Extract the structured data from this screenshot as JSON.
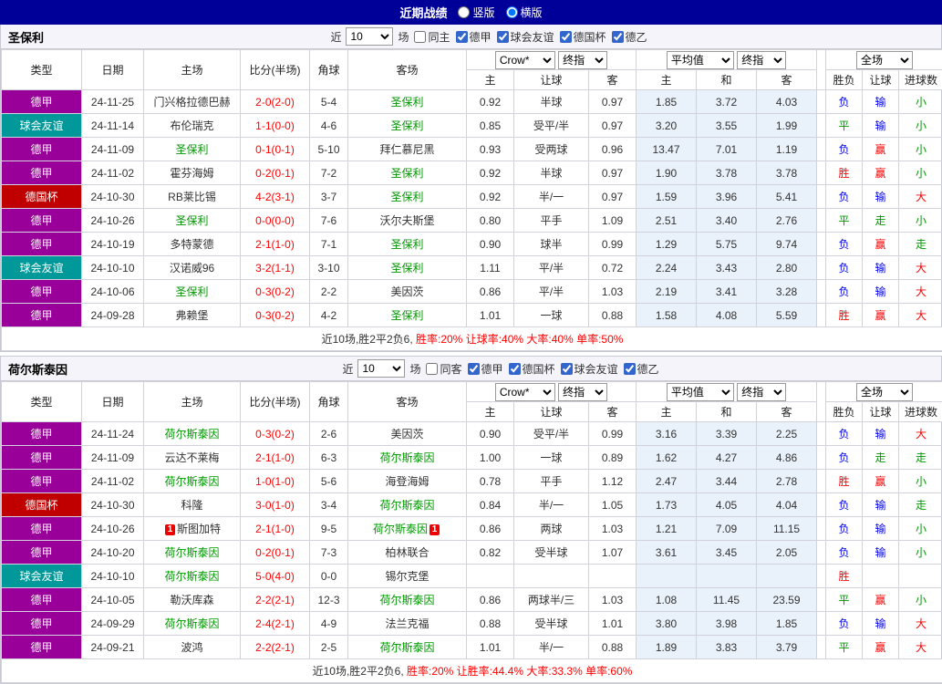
{
  "topbar": {
    "title": "近期战绩",
    "layout_options": [
      {
        "label": "竖版",
        "checked": false
      },
      {
        "label": "横版",
        "checked": true
      }
    ]
  },
  "colors": {
    "topbar_bg": "#000099",
    "league": {
      "德甲": "#990099",
      "球会友谊": "#009898",
      "德国杯": "#C00000"
    },
    "result": {
      "胜": "#FF0000",
      "平": "#009900",
      "负": "#0000EE",
      "赢": "#FF0000",
      "输": "#0000EE",
      "走": "#009900",
      "大": "#FF0000",
      "小": "#009900"
    },
    "focus_team": "#009900",
    "score": "#FF0000",
    "avg_col_bg": "#E9F1FB"
  },
  "table_header": {
    "type": "类型",
    "date": "日期",
    "home": "主场",
    "score": "比分(半场)",
    "corner": "角球",
    "away": "客场",
    "odds_book_select": "Crow*",
    "odds_final_select": "终指",
    "avg_select": "平均值",
    "avg_final_select": "终指",
    "full_select": "全场",
    "odds_sub": [
      "主",
      "让球",
      "客"
    ],
    "avg_sub": [
      "主",
      "和",
      "客"
    ],
    "result_sub": [
      "胜负",
      "让球",
      "进球数"
    ]
  },
  "sections": [
    {
      "team": "圣保利",
      "filter": {
        "near": "近",
        "count": "10",
        "unit": "场",
        "same": {
          "label": "同主",
          "checked": false
        },
        "leagues": [
          {
            "label": "德甲",
            "checked": true
          },
          {
            "label": "球会友谊",
            "checked": true
          },
          {
            "label": "德国杯",
            "checked": true
          },
          {
            "label": "德乙",
            "checked": true
          }
        ]
      },
      "rows": [
        {
          "league": "德甲",
          "date": "24-11-25",
          "home": "门兴格拉德巴赫",
          "score": "2-0(2-0)",
          "corner": "5-4",
          "away": "圣保利",
          "odds": [
            "0.92",
            "半球",
            "0.97"
          ],
          "avg": [
            "1.85",
            "3.72",
            "4.03"
          ],
          "result": [
            "负",
            "输",
            "小"
          ]
        },
        {
          "league": "球会友谊",
          "date": "24-11-14",
          "home": "布伦瑞克",
          "score": "1-1(0-0)",
          "corner": "4-6",
          "away": "圣保利",
          "odds": [
            "0.85",
            "受平/半",
            "0.97"
          ],
          "avg": [
            "3.20",
            "3.55",
            "1.99"
          ],
          "result": [
            "平",
            "输",
            "小"
          ]
        },
        {
          "league": "德甲",
          "date": "24-11-09",
          "home": "圣保利",
          "score": "0-1(0-1)",
          "corner": "5-10",
          "away": "拜仁慕尼黑",
          "odds": [
            "0.93",
            "受两球",
            "0.96"
          ],
          "avg": [
            "13.47",
            "7.01",
            "1.19"
          ],
          "result": [
            "负",
            "赢",
            "小"
          ]
        },
        {
          "league": "德甲",
          "date": "24-11-02",
          "home": "霍芬海姆",
          "score": "0-2(0-1)",
          "corner": "7-2",
          "away": "圣保利",
          "odds": [
            "0.92",
            "半球",
            "0.97"
          ],
          "avg": [
            "1.90",
            "3.78",
            "3.78"
          ],
          "result": [
            "胜",
            "赢",
            "小"
          ]
        },
        {
          "league": "德国杯",
          "date": "24-10-30",
          "home": "RB莱比锡",
          "score": "4-2(3-1)",
          "corner": "3-7",
          "away": "圣保利",
          "odds": [
            "0.92",
            "半/一",
            "0.97"
          ],
          "avg": [
            "1.59",
            "3.96",
            "5.41"
          ],
          "result": [
            "负",
            "输",
            "大"
          ]
        },
        {
          "league": "德甲",
          "date": "24-10-26",
          "home": "圣保利",
          "score": "0-0(0-0)",
          "corner": "7-6",
          "away": "沃尔夫斯堡",
          "odds": [
            "0.80",
            "平手",
            "1.09"
          ],
          "avg": [
            "2.51",
            "3.40",
            "2.76"
          ],
          "result": [
            "平",
            "走",
            "小"
          ]
        },
        {
          "league": "德甲",
          "date": "24-10-19",
          "home": "多特蒙德",
          "score": "2-1(1-0)",
          "corner": "7-1",
          "away": "圣保利",
          "odds": [
            "0.90",
            "球半",
            "0.99"
          ],
          "avg": [
            "1.29",
            "5.75",
            "9.74"
          ],
          "result": [
            "负",
            "赢",
            "走"
          ]
        },
        {
          "league": "球会友谊",
          "date": "24-10-10",
          "home": "汉诺威96",
          "score": "3-2(1-1)",
          "corner": "3-10",
          "away": "圣保利",
          "odds": [
            "1.11",
            "平/半",
            "0.72"
          ],
          "avg": [
            "2.24",
            "3.43",
            "2.80"
          ],
          "result": [
            "负",
            "输",
            "大"
          ]
        },
        {
          "league": "德甲",
          "date": "24-10-06",
          "home": "圣保利",
          "score": "0-3(0-2)",
          "corner": "2-2",
          "away": "美因茨",
          "odds": [
            "0.86",
            "平/半",
            "1.03"
          ],
          "avg": [
            "2.19",
            "3.41",
            "3.28"
          ],
          "result": [
            "负",
            "输",
            "大"
          ]
        },
        {
          "league": "德甲",
          "date": "24-09-28",
          "home": "弗赖堡",
          "score": "0-3(0-2)",
          "corner": "4-2",
          "away": "圣保利",
          "odds": [
            "1.01",
            "一球",
            "0.88"
          ],
          "avg": [
            "1.58",
            "4.08",
            "5.59"
          ],
          "result": [
            "胜",
            "赢",
            "大"
          ]
        }
      ],
      "footer": [
        {
          "text": "近10场,胜2平2负6, ",
          "color": "#333333"
        },
        {
          "text": "胜率:20% ",
          "color": "#FF0000"
        },
        {
          "text": "让球率:40% ",
          "color": "#FF0000"
        },
        {
          "text": "大率:40% ",
          "color": "#FF0000"
        },
        {
          "text": "单率:50%",
          "color": "#FF0000"
        }
      ]
    },
    {
      "team": "荷尔斯泰因",
      "filter": {
        "near": "近",
        "count": "10",
        "unit": "场",
        "same": {
          "label": "同客",
          "checked": false
        },
        "leagues": [
          {
            "label": "德甲",
            "checked": true
          },
          {
            "label": "德国杯",
            "checked": true
          },
          {
            "label": "球会友谊",
            "checked": true
          },
          {
            "label": "德乙",
            "checked": true
          }
        ]
      },
      "rows": [
        {
          "league": "德甲",
          "date": "24-11-24",
          "home": "荷尔斯泰因",
          "score": "0-3(0-2)",
          "corner": "2-6",
          "away": "美因茨",
          "odds": [
            "0.90",
            "受平/半",
            "0.99"
          ],
          "avg": [
            "3.16",
            "3.39",
            "2.25"
          ],
          "result": [
            "负",
            "输",
            "大"
          ]
        },
        {
          "league": "德甲",
          "date": "24-11-09",
          "home": "云达不莱梅",
          "score": "2-1(1-0)",
          "corner": "6-3",
          "away": "荷尔斯泰因",
          "odds": [
            "1.00",
            "一球",
            "0.89"
          ],
          "avg": [
            "1.62",
            "4.27",
            "4.86"
          ],
          "result": [
            "负",
            "走",
            "走"
          ]
        },
        {
          "league": "德甲",
          "date": "24-11-02",
          "home": "荷尔斯泰因",
          "score": "1-0(1-0)",
          "corner": "5-6",
          "away": "海登海姆",
          "odds": [
            "0.78",
            "平手",
            "1.12"
          ],
          "avg": [
            "2.47",
            "3.44",
            "2.78"
          ],
          "result": [
            "胜",
            "赢",
            "小"
          ]
        },
        {
          "league": "德国杯",
          "date": "24-10-30",
          "home": "科隆",
          "score": "3-0(1-0)",
          "corner": "3-4",
          "away": "荷尔斯泰因",
          "odds": [
            "0.84",
            "半/一",
            "1.05"
          ],
          "avg": [
            "1.73",
            "4.05",
            "4.04"
          ],
          "result": [
            "负",
            "输",
            "走"
          ]
        },
        {
          "league": "德甲",
          "date": "24-10-26",
          "home": "斯图加特",
          "home_card": "1",
          "score": "2-1(1-0)",
          "corner": "9-5",
          "away": "荷尔斯泰因",
          "away_card": "1",
          "odds": [
            "0.86",
            "两球",
            "1.03"
          ],
          "avg": [
            "1.21",
            "7.09",
            "11.15"
          ],
          "result": [
            "负",
            "输",
            "小"
          ]
        },
        {
          "league": "德甲",
          "date": "24-10-20",
          "home": "荷尔斯泰因",
          "score": "0-2(0-1)",
          "corner": "7-3",
          "away": "柏林联合",
          "odds": [
            "0.82",
            "受半球",
            "1.07"
          ],
          "avg": [
            "3.61",
            "3.45",
            "2.05"
          ],
          "result": [
            "负",
            "输",
            "小"
          ]
        },
        {
          "league": "球会友谊",
          "date": "24-10-10",
          "home": "荷尔斯泰因",
          "score": "5-0(4-0)",
          "corner": "0-0",
          "away": "锡尔克堡",
          "odds": [
            "",
            "",
            ""
          ],
          "avg": [
            "",
            "",
            ""
          ],
          "result": [
            "胜",
            "",
            ""
          ]
        },
        {
          "league": "德甲",
          "date": "24-10-05",
          "home": "勒沃库森",
          "score": "2-2(2-1)",
          "corner": "12-3",
          "away": "荷尔斯泰因",
          "odds": [
            "0.86",
            "两球半/三",
            "1.03"
          ],
          "avg": [
            "1.08",
            "11.45",
            "23.59"
          ],
          "result": [
            "平",
            "赢",
            "小"
          ]
        },
        {
          "league": "德甲",
          "date": "24-09-29",
          "home": "荷尔斯泰因",
          "score": "2-4(2-1)",
          "corner": "4-9",
          "away": "法兰克福",
          "odds": [
            "0.88",
            "受半球",
            "1.01"
          ],
          "avg": [
            "3.80",
            "3.98",
            "1.85"
          ],
          "result": [
            "负",
            "输",
            "大"
          ]
        },
        {
          "league": "德甲",
          "date": "24-09-21",
          "home": "波鸿",
          "score": "2-2(2-1)",
          "corner": "2-5",
          "away": "荷尔斯泰因",
          "odds": [
            "1.01",
            "半/一",
            "0.88"
          ],
          "avg": [
            "1.89",
            "3.83",
            "3.79"
          ],
          "result": [
            "平",
            "赢",
            "大"
          ]
        }
      ],
      "footer": [
        {
          "text": "近10场,胜2平2负6, ",
          "color": "#333333"
        },
        {
          "text": "胜率:20% ",
          "color": "#FF0000"
        },
        {
          "text": "让胜率:44.4% ",
          "color": "#FF0000"
        },
        {
          "text": "大率:33.3% ",
          "color": "#FF0000"
        },
        {
          "text": "单率:60%",
          "color": "#FF0000"
        }
      ]
    }
  ]
}
